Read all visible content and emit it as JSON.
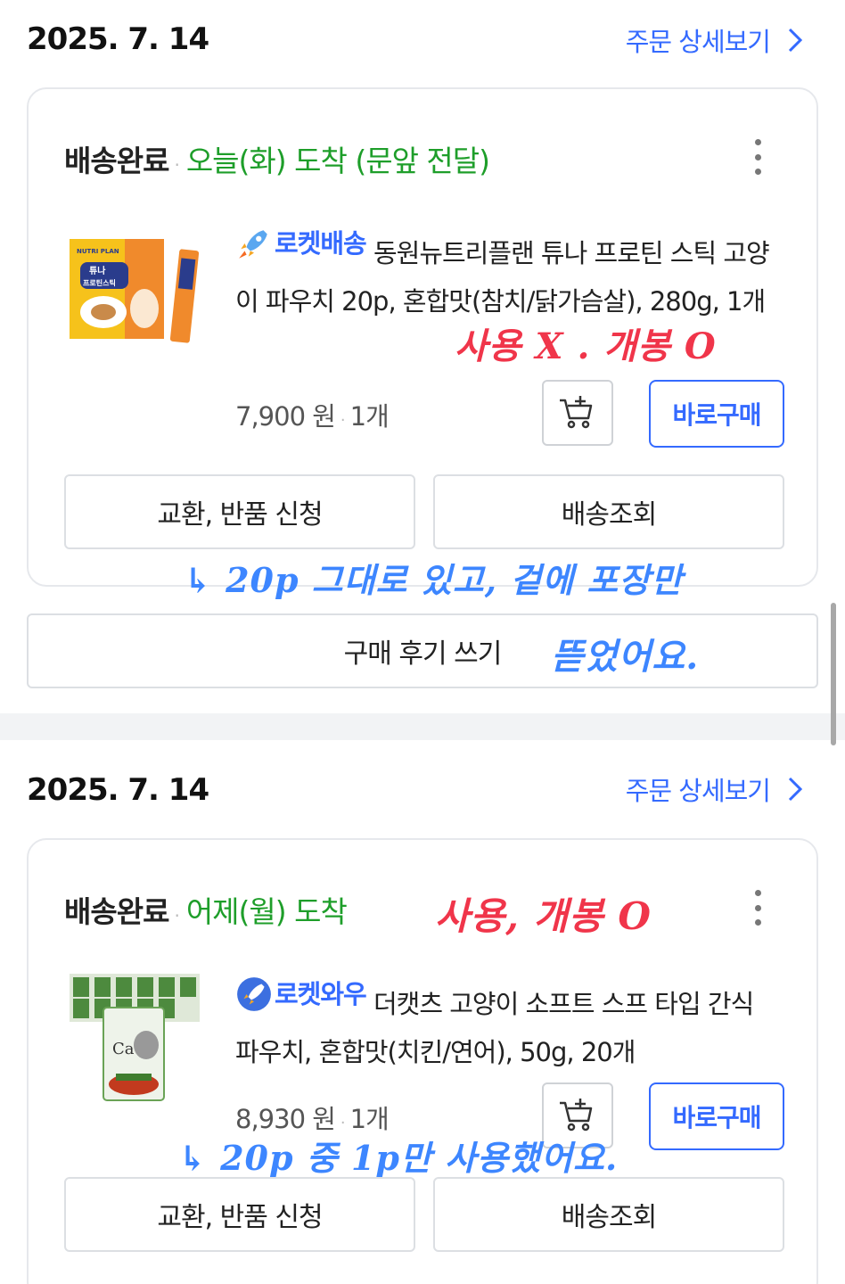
{
  "orders": [
    {
      "date": "2025. 7. 14",
      "detail_link": "주문 상세보기",
      "status": "배송완료",
      "delivery": "오늘(화) 도착 (문앞 전달)",
      "badge": "로켓배송",
      "product_name": "동원뉴트리플랜 튜나 프로틴 스틱 고양이 파우치 20p, 혼합맛(참치/닭가슴살), 280g, 1개",
      "price": "7,900 원",
      "qty": "1개",
      "buy_now": "바로구매",
      "exchange_return": "교환, 반품 신청",
      "track": "배송조회",
      "review": "구매 후기 쓰기",
      "thumbnail_text": [
        "NUTRI PLAN",
        "튜나",
        "프로틴스틱"
      ]
    },
    {
      "date": "2025. 7. 14",
      "detail_link": "주문 상세보기",
      "status": "배송완료",
      "delivery": "어제(월) 도착",
      "badge": "로켓와우",
      "product_name": "더캣츠 고양이 소프트 스프 타입 간식 파우치, 혼합맛(치킨/연어), 50g, 20개",
      "price": "8,930 원",
      "qty": "1개",
      "buy_now": "바로구매",
      "exchange_return": "교환, 반품 신청",
      "track": "배송조회",
      "thumbnail_text": [
        "Cat"
      ]
    }
  ],
  "handwritten": {
    "note1": "사용 X . 개봉 O",
    "note2_line1": "↳ 20p 그대로 있고, 겉에 포장만",
    "note2_line2": "뜯었어요.",
    "note3": "사용, 개봉 O",
    "note4": "↳ 20p 중 1p만 사용했어요."
  },
  "colors": {
    "accent_blue": "#346aff",
    "delivered_green": "#1e9e2a",
    "note_red": "#f0354a",
    "note_blue": "#3d86ff"
  }
}
